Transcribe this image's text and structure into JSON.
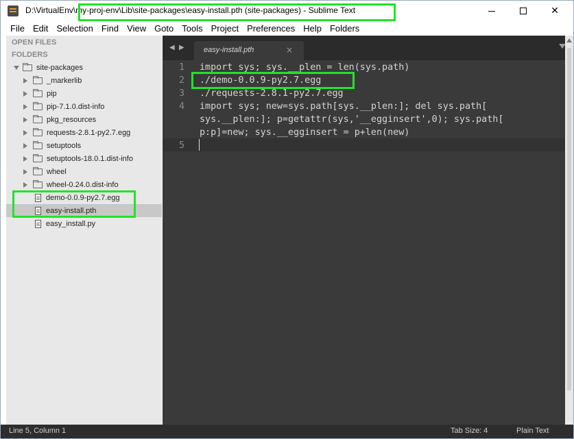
{
  "window": {
    "title": "D:\\VirtualEnv\\my-proj-env\\Lib\\site-packages\\easy-install.pth (site-packages) - Sublime Text",
    "controls": {
      "minimize": "—",
      "maximize": "☐",
      "close": "✕"
    }
  },
  "menu": [
    "File",
    "Edit",
    "Selection",
    "Find",
    "View",
    "Goto",
    "Tools",
    "Project",
    "Preferences",
    "Help",
    "Folders"
  ],
  "sidebar": {
    "open_files_label": "OPEN FILES",
    "folders_label": "FOLDERS",
    "root": "site-packages",
    "folders": [
      "_markerlib",
      "pip",
      "pip-7.1.0.dist-info",
      "pkg_resources",
      "requests-2.8.1-py2.7.egg",
      "setuptools",
      "setuptools-18.0.1.dist-info",
      "wheel",
      "wheel-0.24.0.dist-info"
    ],
    "files": [
      "demo-0.0.9-py2.7.egg",
      "easy-install.pth",
      "easy_install.py"
    ],
    "selected_file": "easy-install.pth"
  },
  "tabs": {
    "active_label": "easy-install.pth",
    "close_glyph": "×",
    "nav_left": "◀",
    "nav_right": "▶"
  },
  "editor": {
    "line_numbers": [
      "1",
      "2",
      "3",
      "4",
      "",
      "",
      "5"
    ],
    "lines": [
      "import sys; sys.__plen = len(sys.path)",
      "./demo-0.0.9-py2.7.egg",
      "./requests-2.8.1-py2.7.egg",
      "import sys; new=sys.path[sys.__plen:]; del sys.path[",
      "sys.__plen:]; p=getattr(sys,'__egginsert',0); sys.path[",
      "p:p]=new; sys.__egginsert = p+len(new)",
      ""
    ]
  },
  "statusbar": {
    "position": "Line 5, Column 1",
    "tab_size": "Tab Size: 4",
    "syntax": "Plain Text"
  },
  "colors": {
    "highlight": "#22e32a",
    "editor_bg": "#3a3a3a",
    "sidebar_bg": "#e8e8e8"
  }
}
